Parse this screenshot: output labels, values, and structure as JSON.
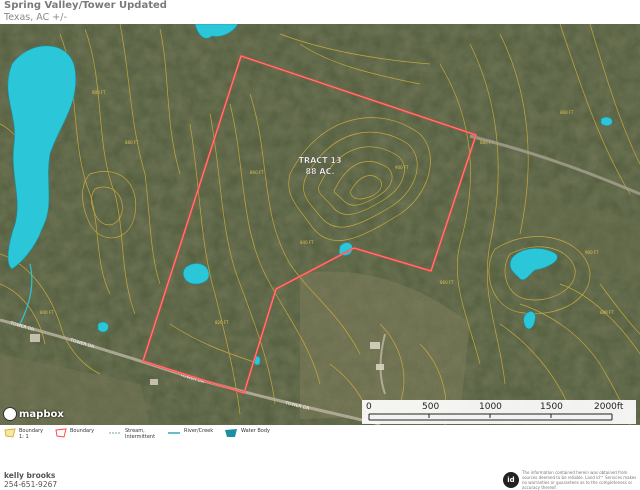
{
  "header": {
    "title": "Spring Valley/Tower Updated",
    "subtitle": "Texas, AC +/-"
  },
  "map": {
    "tract_label_line1": "TRACT 13",
    "tract_label_line2": "88 AC.",
    "road_labels": [
      "TOWER DR",
      "TOWER DR",
      "TOWER DR",
      "TOWER DR"
    ],
    "contour_labels": [
      "900 FT",
      "880 FT",
      "860 FT",
      "840 FT",
      "820 FT",
      "900 FT",
      "880 FT",
      "860 FT",
      "900 FT",
      "880 FT",
      "840 FT",
      "860 FT"
    ],
    "colors": {
      "boundary": "#ff4a4a",
      "contour": "#d9b23a",
      "water": "#2bc6d8",
      "imagery_base": "#4f5a3c"
    }
  },
  "scale_bar": {
    "labels": [
      "0",
      "500",
      "1000",
      "1500",
      "2000ft"
    ]
  },
  "attribution": {
    "mapbox": "mapbox"
  },
  "legend": {
    "items": [
      {
        "icon": "boundary-polygon-icon",
        "label": "Boundary 1: 1"
      },
      {
        "icon": "boundary-outline-icon",
        "label": "Boundary"
      },
      {
        "icon": "stream-intermittent-icon",
        "label": "Stream, Intermittent"
      },
      {
        "icon": "river-creek-icon",
        "label": "River/Creek"
      },
      {
        "icon": "water-body-icon",
        "label": "Water Body"
      }
    ]
  },
  "footer": {
    "agent_name": "kelly brooks",
    "phone": "254-651-9267",
    "brand_mark": "id",
    "disclaimer": "The information contained herein was obtained from sources deemed to be reliable. Land id™ Services makes no warranties or guarantees as to the completeness or accuracy thereof."
  }
}
